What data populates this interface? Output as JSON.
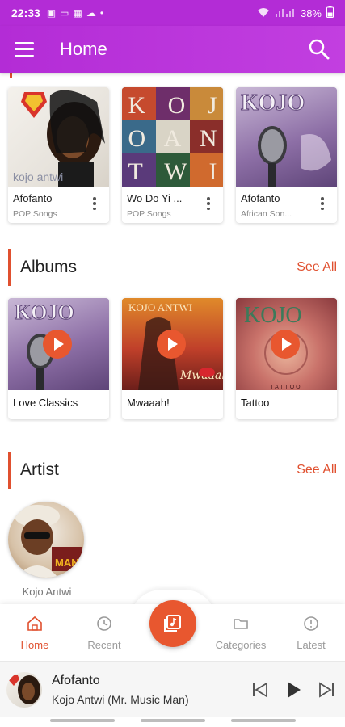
{
  "status_bar": {
    "time": "22:33",
    "battery": "38%"
  },
  "app_bar": {
    "title": "Home"
  },
  "songs": [
    {
      "title": "Afofanto",
      "subtitle": "POP Songs"
    },
    {
      "title": "Wo Do Yi ...",
      "subtitle": "POP Songs"
    },
    {
      "title": "Afofanto",
      "subtitle": "African Son..."
    }
  ],
  "albums_section": {
    "title": "Albums",
    "see_all": "See All"
  },
  "albums": [
    {
      "title": "Love Classics"
    },
    {
      "title": "Mwaaah!"
    },
    {
      "title": "Tattoo"
    }
  ],
  "artist_section": {
    "title": "Artist",
    "see_all": "See All"
  },
  "artists": [
    {
      "name": "Kojo Antwi"
    }
  ],
  "artwork_text": {
    "cover1": "kojo antwi",
    "cover2_rows": [
      "K O J",
      "O A N",
      "T W I"
    ],
    "cover3": "KOJO",
    "cover_album1": "KOJO",
    "cover_album2": "KOJO ANTWI",
    "cover_album2_script": "Mwaaah!",
    "cover_album3": "KOJO",
    "cover_album3_sub": "TATTOO",
    "artist_badge": "MAN"
  },
  "bottom_nav": {
    "items": [
      {
        "label": "Home",
        "icon": "home-icon",
        "active": true
      },
      {
        "label": "Recent",
        "icon": "history-icon",
        "active": false
      },
      {
        "label": "Categories",
        "icon": "folder-icon",
        "active": false
      },
      {
        "label": "Latest",
        "icon": "info-icon",
        "active": false
      }
    ]
  },
  "player": {
    "title": "Afofanto",
    "artist": "Kojo Antwi (Mr. Music Man)"
  },
  "colors": {
    "primary": "#b32cd6",
    "accent": "#e0502f"
  }
}
